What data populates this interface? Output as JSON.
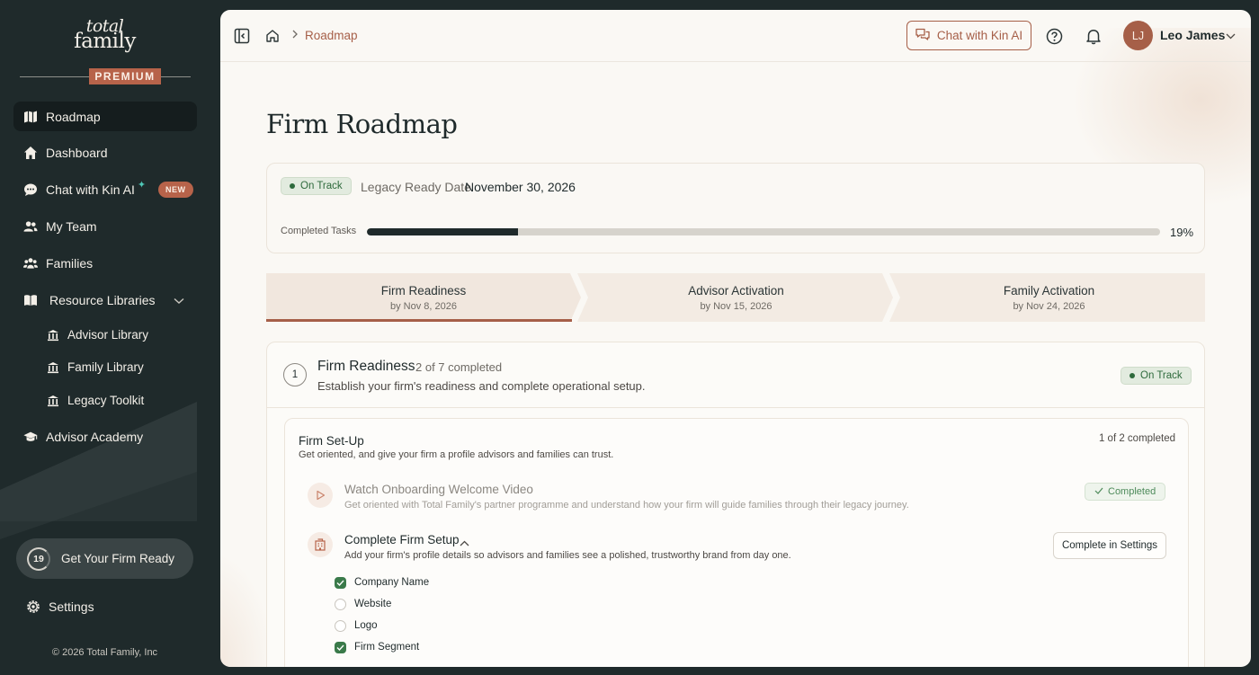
{
  "sidebar": {
    "logo_line1": "total",
    "logo_line2": "family",
    "premium_label": "PREMIUM",
    "items": [
      {
        "label": "Roadmap",
        "icon": "map-icon"
      },
      {
        "label": "Dashboard",
        "icon": "home-icon"
      },
      {
        "label": "Chat with Kin AI",
        "icon": "chat-icon",
        "badge": "NEW"
      },
      {
        "label": "My Team",
        "icon": "team-icon"
      },
      {
        "label": "Families",
        "icon": "families-icon"
      },
      {
        "label": "Resource Libraries",
        "icon": "book-icon"
      }
    ],
    "sub_items": [
      {
        "label": "Advisor Library",
        "icon": "library-icon"
      },
      {
        "label": "Family Library",
        "icon": "library-icon"
      },
      {
        "label": "Legacy Toolkit",
        "icon": "library-icon"
      }
    ],
    "academy_label": "Advisor Academy",
    "firm_ready": {
      "count": "19",
      "label": "Get Your Firm Ready"
    },
    "settings_label": "Settings",
    "copyright": "© 2026 Total Family, Inc"
  },
  "topbar": {
    "breadcrumb": "Roadmap",
    "chat_button": "Chat with Kin AI",
    "user": {
      "initials": "LJ",
      "name": "Leo James"
    }
  },
  "page": {
    "title": "Firm Roadmap",
    "summary": {
      "status": "On Track",
      "legacy_label": "Legacy Ready Date",
      "legacy_date": "November 30, 2026",
      "completed_label": "Completed Tasks",
      "progress_percent": 19,
      "progress_text": "19%"
    },
    "steps": [
      {
        "title": "Firm Readiness",
        "date": "by Nov 8, 2026",
        "active": true
      },
      {
        "title": "Advisor Activation",
        "date": "by Nov 15, 2026",
        "active": false
      },
      {
        "title": "Family Activation",
        "date": "by Nov 24, 2026",
        "active": false
      }
    ],
    "phase": {
      "number": "1",
      "title": "Firm Readiness",
      "count": "2 of 7 completed",
      "description": "Establish your firm's readiness and complete operational setup.",
      "status": "On Track",
      "group": {
        "title": "Firm Set-Up",
        "description": "Get oriented, and give your firm a profile advisors and families can trust.",
        "count": "1 of 2 completed",
        "tasks": [
          {
            "title": "Watch Onboarding Welcome Video",
            "description": "Get oriented with Total Family's partner programme and understand how your firm will guide families through their legacy journey.",
            "status": "Completed",
            "icon": "play-icon"
          },
          {
            "title": "Complete Firm Setup",
            "description": "Add your firm's profile details so advisors and families see a polished, trustworthy brand from day one.",
            "action": "Complete in Settings",
            "icon": "building-icon",
            "checklist": [
              {
                "label": "Company Name",
                "checked": true
              },
              {
                "label": "Website",
                "checked": false
              },
              {
                "label": "Logo",
                "checked": false
              },
              {
                "label": "Firm Segment",
                "checked": true
              }
            ]
          }
        ]
      }
    }
  },
  "colors": {
    "sidebar_bg": "#1f2a2b",
    "accent": "#a65f48",
    "success": "#2e6a3c",
    "panel_bg": "#faf8f4"
  }
}
